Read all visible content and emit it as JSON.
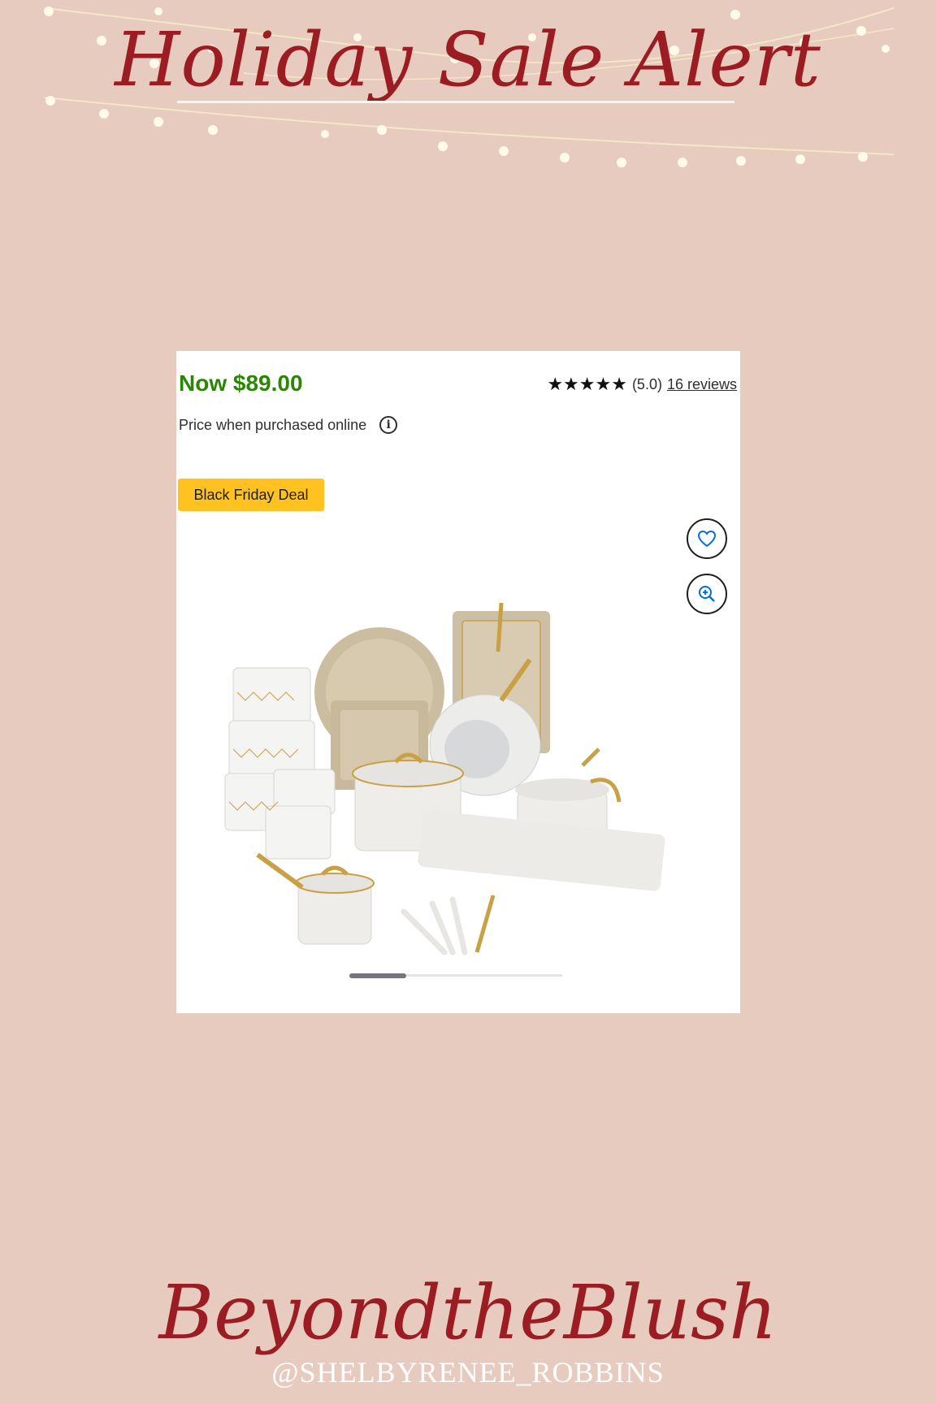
{
  "header": {
    "title": "Holiday Sale Alert"
  },
  "product": {
    "price": "Now $89.00",
    "stars": "★★★★★",
    "rating": "(5.0)",
    "reviews_link": "16 reviews",
    "price_note": "Price when purchased online",
    "badge": "Black Friday Deal",
    "image_alt": "Cookware set with pots, pans, bakeware, storage containers and utensils"
  },
  "footer": {
    "brand": "BeyondtheBlush",
    "handle": "@SHELBYRENEE_ROBBINS"
  },
  "colors": {
    "background": "#e8cbbf",
    "script_red": "#9b1c22",
    "price_green": "#2a8703",
    "badge_yellow": "#ffc220",
    "icon_blue": "#0071dc"
  },
  "icons": [
    "info-icon",
    "heart-icon",
    "zoom-in-icon",
    "star-icon"
  ]
}
